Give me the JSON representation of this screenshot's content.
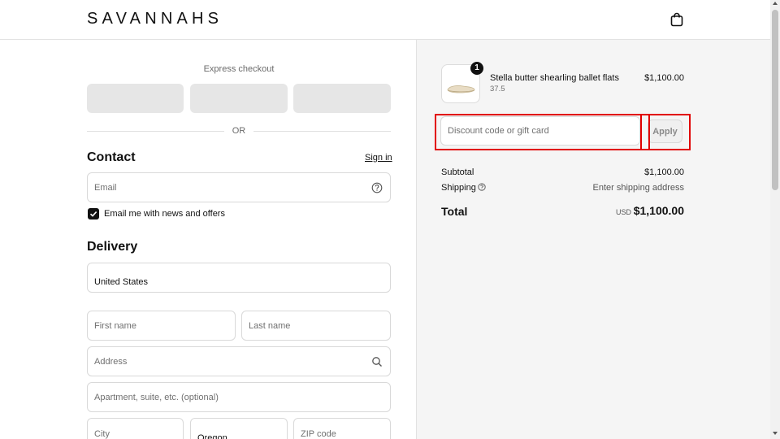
{
  "header": {
    "logo": "SAVANNAHS",
    "cart_icon": "shopping-bag-icon"
  },
  "express": {
    "title": "Express checkout",
    "divider": "OR"
  },
  "contact": {
    "title": "Contact",
    "sign_in": "Sign in",
    "email_placeholder": "Email",
    "email_help_icon": "question-circle-icon",
    "newsletter_label": "Email me with news and offers",
    "newsletter_checked": true
  },
  "delivery": {
    "title": "Delivery",
    "country": "United States",
    "first_name_placeholder": "First name",
    "last_name_placeholder": "Last name",
    "address_placeholder": "Address",
    "apartment_placeholder": "Apartment, suite, etc. (optional)",
    "city_placeholder": "City",
    "state": "Oregon",
    "zip_placeholder": "ZIP code"
  },
  "summary": {
    "item": {
      "quantity": "1",
      "name": "Stella butter shearling ballet flats",
      "variant": "37.5",
      "price": "$1,100.00"
    },
    "discount_placeholder": "Discount code or gift card",
    "apply_label": "Apply",
    "subtotal_label": "Subtotal",
    "subtotal_value": "$1,100.00",
    "shipping_label": "Shipping",
    "shipping_value": "Enter shipping address",
    "total_label": "Total",
    "currency": "USD",
    "total_value": "$1,100.00"
  },
  "colors": {
    "highlight": "#e10000",
    "summary_bg": "#f5f5f5",
    "express_button": "#e6e6e6"
  }
}
